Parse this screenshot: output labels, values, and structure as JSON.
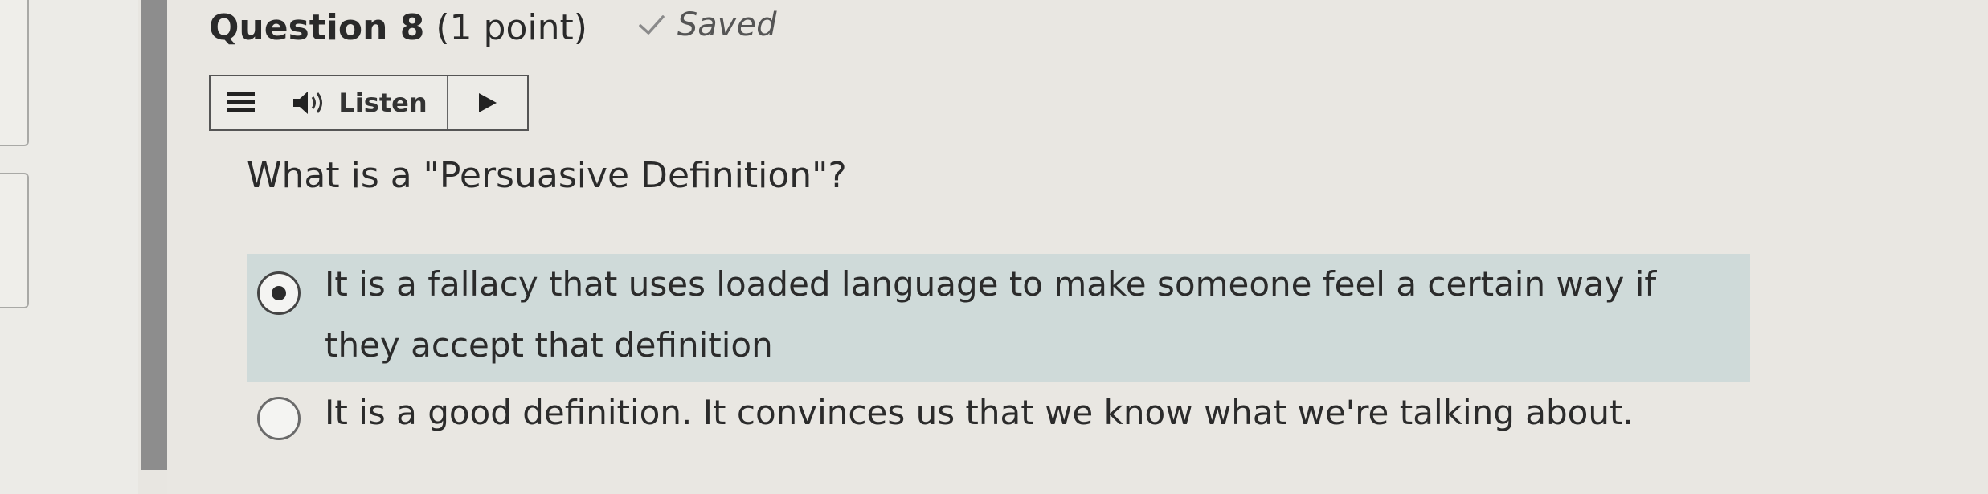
{
  "question": {
    "title": "Question 8",
    "points": "(1 point)",
    "saved_label": "Saved",
    "text": "What is a \"Persuasive Definition\"?"
  },
  "toolbar": {
    "listen_label": "Listen",
    "icons": [
      "menu-icon",
      "speaker-icon",
      "play-icon"
    ]
  },
  "options": [
    {
      "text": "It is a fallacy that uses loaded language to make someone feel a certain way if they accept that definition",
      "selected": true
    },
    {
      "text": "It is a good definition.  It convinces us that we know what we're talking about.",
      "selected": false
    }
  ],
  "colors": {
    "selected_option_bg": "#cfdad9",
    "page_bg": "#e9e7e2",
    "side_bar": "#8d8d8d"
  }
}
